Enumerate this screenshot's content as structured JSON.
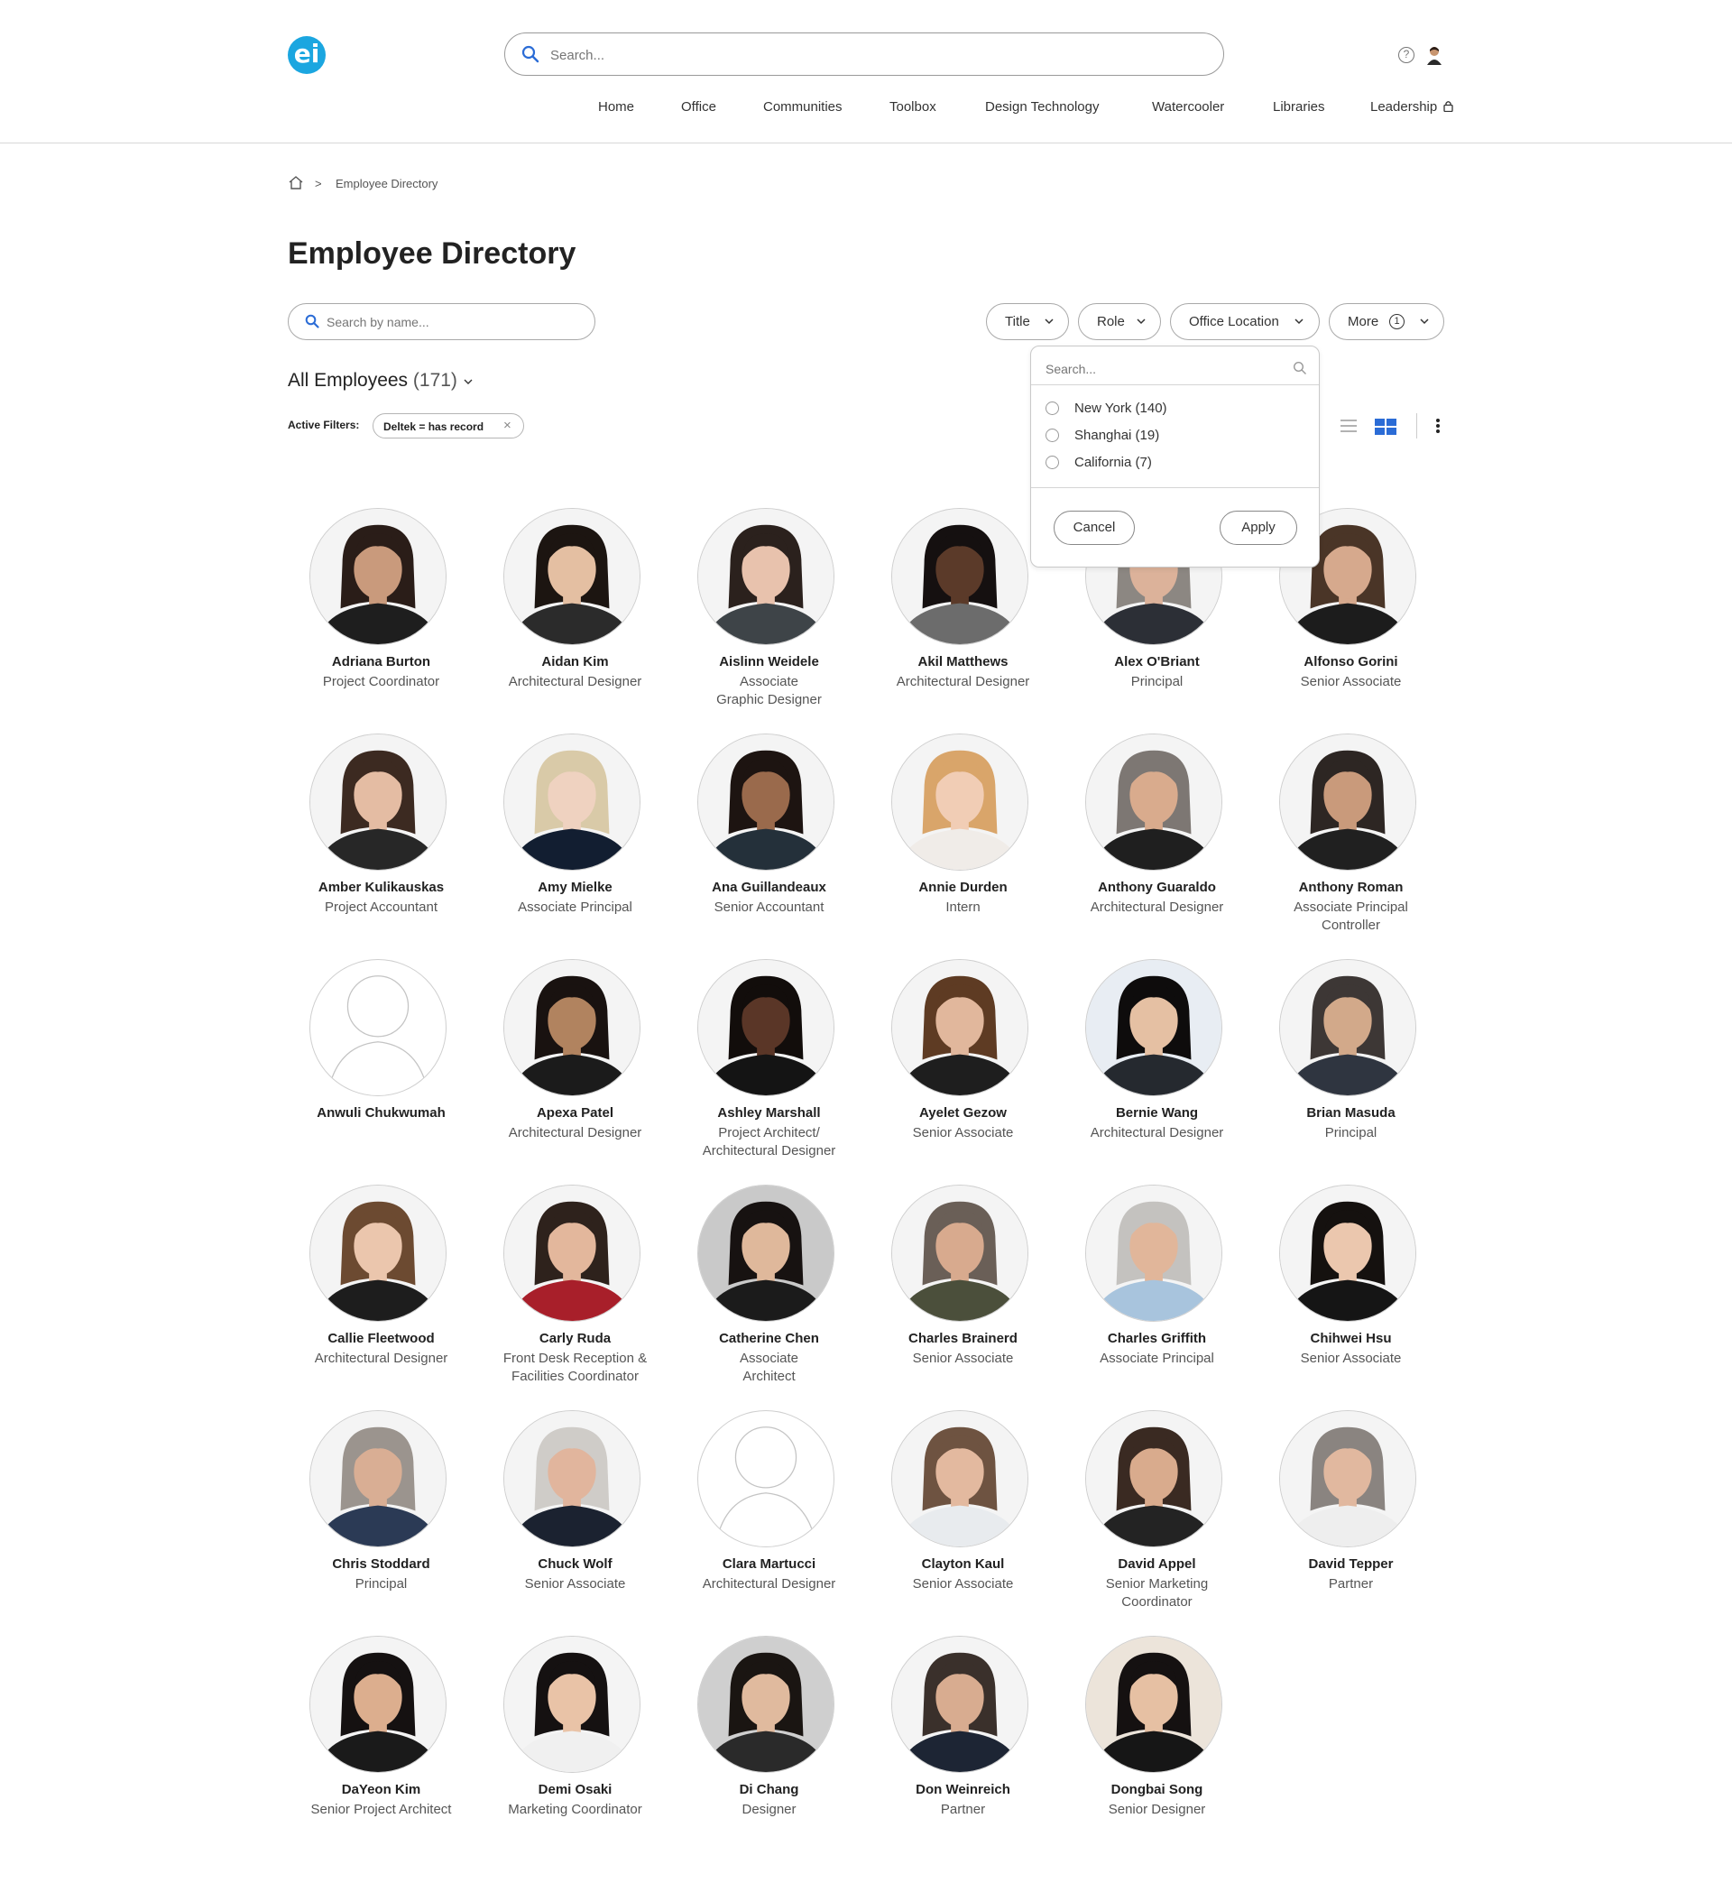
{
  "header": {
    "logo_text": "ei",
    "search_placeholder": "Search...",
    "help_text": "?",
    "nav": [
      "Home",
      "Office",
      "Communities",
      "Toolbox",
      "Design Technology",
      "Watercooler",
      "Libraries",
      "Leadership"
    ]
  },
  "breadcrumb": {
    "separator": ">",
    "current": "Employee Directory"
  },
  "page_title": "Employee Directory",
  "name_search_placeholder": "Search by name...",
  "filters": {
    "title": "Title",
    "role": "Role",
    "office_location": "Office Location",
    "more": "More",
    "more_count": "1"
  },
  "all_employees": {
    "label": "All Employees",
    "count": "(171)"
  },
  "active_filters": {
    "label": "Active Filters:",
    "chip": "Deltek = has record",
    "chip_remove": "×"
  },
  "location_dropdown": {
    "search_placeholder": "Search...",
    "options": [
      "New York (140)",
      "Shanghai (19)",
      "California (7)"
    ],
    "cancel": "Cancel",
    "apply": "Apply"
  },
  "colors": {
    "brand": "#1ba6e0",
    "grid_view_active": "#2b6cd6"
  },
  "employees": [
    {
      "name": "Adriana Burton",
      "title": "Project Coordinator",
      "photo": true,
      "skin": "#c99a7c",
      "hair": "#2a1d18",
      "bg": "#f4f4f4",
      "shirt": "#1e1e1e"
    },
    {
      "name": "Aidan Kim",
      "title": "Architectural Designer",
      "photo": true,
      "skin": "#e4bfa2",
      "hair": "#1c1511",
      "bg": "#f4f4f4",
      "shirt": "#2b2b2b"
    },
    {
      "name": "Aislinn Weidele",
      "title": "Associate\nGraphic Designer",
      "photo": true,
      "skin": "#e8c2ad",
      "hair": "#2b211d",
      "bg": "#f4f4f4",
      "shirt": "#3e4448"
    },
    {
      "name": "Akil Matthews",
      "title": "Architectural Designer",
      "photo": true,
      "skin": "#5b3a29",
      "hair": "#151010",
      "bg": "#f4f4f4",
      "shirt": "#6c6c6c"
    },
    {
      "name": "Alex O'Briant",
      "title": "Principal",
      "photo": true,
      "skin": "#dcb29a",
      "hair": "#8c8782",
      "bg": "#f4f4f4",
      "shirt": "#2c2f36"
    },
    {
      "name": "Alfonso Gorini",
      "title": "Senior Associate",
      "photo": true,
      "skin": "#d6a98d",
      "hair": "#4a3527",
      "bg": "#f4f4f4",
      "shirt": "#1c1c1c"
    },
    {
      "name": "Amber Kulikauskas",
      "title": "Project Accountant",
      "photo": true,
      "skin": "#e4bca3",
      "hair": "#3c2a21",
      "bg": "#f4f4f4",
      "shirt": "#272727"
    },
    {
      "name": "Amy Mielke",
      "title": "Associate Principal",
      "photo": true,
      "skin": "#efd2c0",
      "hair": "#d9caa8",
      "bg": "#f4f4f4",
      "shirt": "#121e31"
    },
    {
      "name": "Ana Guillandeaux",
      "title": "Senior Accountant",
      "photo": true,
      "skin": "#9a6a4c",
      "hair": "#1d1411",
      "bg": "#f4f4f4",
      "shirt": "#24303a"
    },
    {
      "name": "Annie Durden",
      "title": "Intern",
      "photo": true,
      "skin": "#f1cdb5",
      "hair": "#d9a56a",
      "bg": "#f4f4f4",
      "shirt": "#f0ece8"
    },
    {
      "name": "Anthony Guaraldo",
      "title": "Architectural Designer",
      "photo": true,
      "skin": "#d9ab8d",
      "hair": "#7d7773",
      "bg": "#f4f4f4",
      "shirt": "#1f1f1f"
    },
    {
      "name": "Anthony Roman",
      "title": "Associate Principal\nController",
      "photo": true,
      "skin": "#c99a7b",
      "hair": "#2d2623",
      "bg": "#f4f4f4",
      "shirt": "#202020"
    },
    {
      "name": "Anwuli Chukwumah",
      "title": "",
      "photo": false
    },
    {
      "name": "Apexa Patel",
      "title": "Architectural Designer",
      "photo": true,
      "skin": "#b1835f",
      "hair": "#191210",
      "bg": "#f4f4f4",
      "shirt": "#1b1b1b"
    },
    {
      "name": "Ashley Marshall",
      "title": "Project Architect/\nArchitectural Designer",
      "photo": true,
      "skin": "#5a3627",
      "hair": "#120d0b",
      "bg": "#f4f4f4",
      "shirt": "#141414"
    },
    {
      "name": "Ayelet Gezow",
      "title": "Senior Associate",
      "photo": true,
      "skin": "#e1b79c",
      "hair": "#5e3b23",
      "bg": "#f4f4f4",
      "shirt": "#1e1e1e"
    },
    {
      "name": "Bernie Wang",
      "title": "Architectural Designer",
      "photo": true,
      "skin": "#e5c0a3",
      "hair": "#0e0c0c",
      "bg": "#e8edf3",
      "shirt": "#25292f"
    },
    {
      "name": "Brian Masuda",
      "title": "Principal",
      "photo": true,
      "skin": "#d2a98a",
      "hair": "#3d3735",
      "bg": "#f4f4f4",
      "shirt": "#2f3540"
    },
    {
      "name": "Callie Fleetwood",
      "title": "Architectural Designer",
      "photo": true,
      "skin": "#ebc6ad",
      "hair": "#6c4a31",
      "bg": "#f4f4f4",
      "shirt": "#1d1d1d"
    },
    {
      "name": "Carly Ruda",
      "title": "Front Desk Reception &\nFacilities Coordinator",
      "photo": true,
      "skin": "#e3b79c",
      "hair": "#2e221c",
      "bg": "#f4f4f4",
      "shirt": "#a81f2a"
    },
    {
      "name": "Catherine Chen",
      "title": "Associate\nArchitect",
      "photo": true,
      "skin": "#dfb89b",
      "hair": "#171211",
      "bg": "#c9c9c9",
      "shirt": "#1b1b1b"
    },
    {
      "name": "Charles Brainerd",
      "title": "Senior Associate",
      "photo": true,
      "skin": "#d8aa8e",
      "hair": "#6a5f57",
      "bg": "#f4f4f4",
      "shirt": "#4b4f3b"
    },
    {
      "name": "Charles Griffith",
      "title": "Associate Principal",
      "photo": true,
      "skin": "#e1b69a",
      "hair": "#c4c2bf",
      "bg": "#f4f4f4",
      "shirt": "#a8c4dd"
    },
    {
      "name": "Chihwei Hsu",
      "title": "Senior Associate",
      "photo": true,
      "skin": "#ebc7ae",
      "hair": "#15110f",
      "bg": "#f4f4f4",
      "shirt": "#151515"
    },
    {
      "name": "Chris Stoddard",
      "title": "Principal",
      "photo": true,
      "skin": "#d9ae94",
      "hair": "#9b948e",
      "bg": "#f4f4f4",
      "shirt": "#2b3a55"
    },
    {
      "name": "Chuck Wolf",
      "title": "Senior Associate",
      "photo": true,
      "skin": "#e1b59d",
      "hair": "#cfccc8",
      "bg": "#f4f4f4",
      "shirt": "#1b2230"
    },
    {
      "name": "Clara Martucci",
      "title": "Architectural Designer",
      "photo": false
    },
    {
      "name": "Clayton Kaul",
      "title": "Senior Associate",
      "photo": true,
      "skin": "#e3b99f",
      "hair": "#6e5341",
      "bg": "#f4f4f4",
      "shirt": "#e8ebee"
    },
    {
      "name": "David Appel",
      "title": "Senior Marketing\nCoordinator",
      "photo": true,
      "skin": "#d9ab8d",
      "hair": "#3a2a22",
      "bg": "#f4f4f4",
      "shirt": "#232323"
    },
    {
      "name": "David Tepper",
      "title": "Partner",
      "photo": true,
      "skin": "#e1b89f",
      "hair": "#8a8480",
      "bg": "#f4f4f4",
      "shirt": "#eeeeee"
    },
    {
      "name": "DaYeon Kim",
      "title": "Senior Project Architect",
      "photo": true,
      "skin": "#dcae8e",
      "hair": "#151111",
      "bg": "#f4f4f4",
      "shirt": "#1a1a1a"
    },
    {
      "name": "Demi Osaki",
      "title": "Marketing Coordinator",
      "photo": true,
      "skin": "#e9c3a7",
      "hair": "#151111",
      "bg": "#f4f4f4",
      "shirt": "#f0f0f0"
    },
    {
      "name": "Di Chang",
      "title": "Designer",
      "photo": true,
      "skin": "#e0ba9e",
      "hair": "#1a1512",
      "bg": "#cfcfcf",
      "shirt": "#2a2a2a"
    },
    {
      "name": "Don Weinreich",
      "title": "Partner",
      "photo": true,
      "skin": "#d8ac90",
      "hair": "#3a302b",
      "bg": "#f4f4f4",
      "shirt": "#1d2534"
    },
    {
      "name": "Dongbai Song",
      "title": "Senior Designer",
      "photo": true,
      "skin": "#e6c0a3",
      "hair": "#151111",
      "bg": "#ece4da",
      "shirt": "#161616"
    }
  ]
}
